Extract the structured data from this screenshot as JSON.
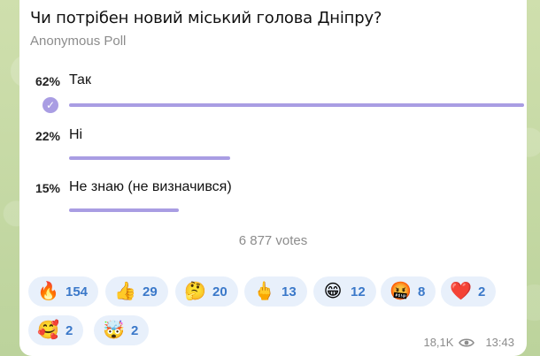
{
  "poll": {
    "question": "Чи потрібен новий міський голова Дніпру?",
    "type": "Anonymous Poll",
    "options": [
      {
        "percent": "62%",
        "label": "Так",
        "fraction": 0.62,
        "chosen": true
      },
      {
        "percent": "22%",
        "label": "Ні",
        "fraction": 0.22,
        "chosen": false
      },
      {
        "percent": "15%",
        "label": "Не знаю (не визначився)",
        "fraction": 0.15,
        "chosen": false
      }
    ],
    "votes": "6 877 votes"
  },
  "reactions": [
    {
      "emoji": "🔥",
      "icon": "fire-icon",
      "count": "154"
    },
    {
      "emoji": "👍",
      "icon": "thumbs-up-icon",
      "count": "29"
    },
    {
      "emoji": "🤔",
      "icon": "thinking-face-icon",
      "count": "20"
    },
    {
      "emoji": "🖕",
      "icon": "middle-finger-icon",
      "count": "13"
    },
    {
      "emoji": "😁",
      "icon": "grinning-face-icon",
      "count": "12"
    },
    {
      "emoji": "🤬",
      "icon": "cursing-face-icon",
      "count": "8"
    },
    {
      "emoji": "❤️",
      "icon": "red-heart-icon",
      "count": "2"
    },
    {
      "emoji": "🥰",
      "icon": "smiling-face-hearts-icon",
      "count": "2"
    },
    {
      "emoji": "🤯",
      "icon": "exploding-head-icon",
      "count": "2"
    }
  ],
  "footer": {
    "views": "18,1K",
    "time": "13:43"
  },
  "colors": {
    "bar": "#a99de3",
    "reaction_bg": "#e8f0fb",
    "reaction_text": "#3a78c9",
    "muted": "#8c8c8c"
  }
}
